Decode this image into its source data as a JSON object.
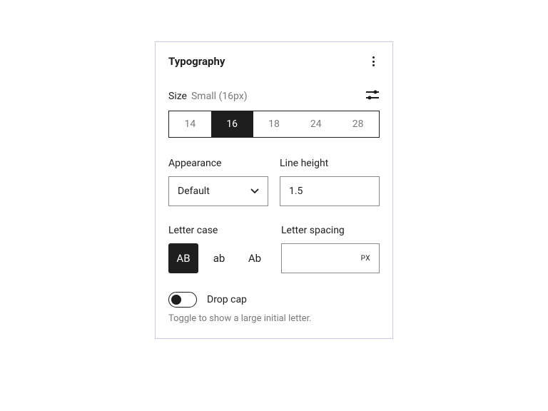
{
  "panel": {
    "title": "Typography"
  },
  "size": {
    "label": "Size",
    "hint": "Small (16px)",
    "options": [
      "14",
      "16",
      "18",
      "24",
      "28"
    ],
    "selected": "16"
  },
  "appearance": {
    "label": "Appearance",
    "value": "Default"
  },
  "lineHeight": {
    "label": "Line height",
    "value": "1.5"
  },
  "letterCase": {
    "label": "Letter case",
    "options": [
      "AB",
      "ab",
      "Ab"
    ],
    "selected": "AB"
  },
  "letterSpacing": {
    "label": "Letter spacing",
    "unit": "PX"
  },
  "dropCap": {
    "label": "Drop cap",
    "help": "Toggle to show a large initial letter.",
    "enabled": false
  }
}
